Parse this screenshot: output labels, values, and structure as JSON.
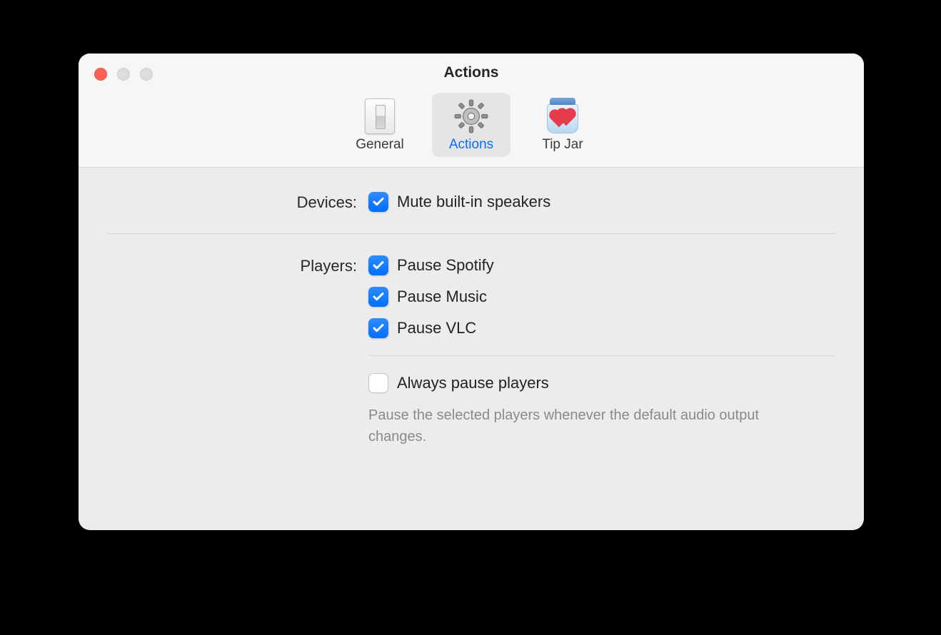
{
  "window": {
    "title": "Actions",
    "traffic": {
      "close": "#ff5f57",
      "minimize": "#dcdcdc",
      "zoom": "#dcdcdc"
    }
  },
  "tabs": {
    "general": {
      "label": "General",
      "selected": false
    },
    "actions": {
      "label": "Actions",
      "selected": true
    },
    "tipjar": {
      "label": "Tip Jar",
      "selected": false
    }
  },
  "sections": {
    "devices": {
      "label": "Devices:",
      "items": [
        {
          "id": "mute-builtin",
          "label": "Mute built-in speakers",
          "checked": true
        }
      ]
    },
    "players": {
      "label": "Players:",
      "items": [
        {
          "id": "pause-spotify",
          "label": "Pause Spotify",
          "checked": true
        },
        {
          "id": "pause-music",
          "label": "Pause Music",
          "checked": true
        },
        {
          "id": "pause-vlc",
          "label": "Pause VLC",
          "checked": true
        }
      ],
      "always": {
        "label": "Always pause players",
        "checked": false,
        "help": "Pause the selected players whenever the default audio output changes."
      }
    }
  }
}
